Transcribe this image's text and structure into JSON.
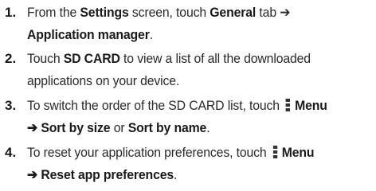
{
  "steps": [
    {
      "number": "1.",
      "t1": "From the ",
      "b1": "Settings",
      "t2": " screen, touch ",
      "b2": "General",
      "t3": " tab ➔",
      "b3": "Application manager",
      "t4": "."
    },
    {
      "number": "2.",
      "t1": "Touch ",
      "b1": "SD CARD",
      "t2": " to view a list of all the downloaded",
      "t3": "applications on your device."
    },
    {
      "number": "3.",
      "t1": "To switch the order of the SD CARD list, touch ",
      "icon": "menu-icon",
      "b1": "Menu",
      "b2": "➔ Sort by size",
      "t2": " or ",
      "b3": "Sort by name",
      "t3": "."
    },
    {
      "number": "4.",
      "t1": "To reset your application preferences, touch ",
      "icon": "menu-icon",
      "b1": "Menu",
      "b2": "➔ Reset app preferences",
      "t2": "."
    }
  ]
}
